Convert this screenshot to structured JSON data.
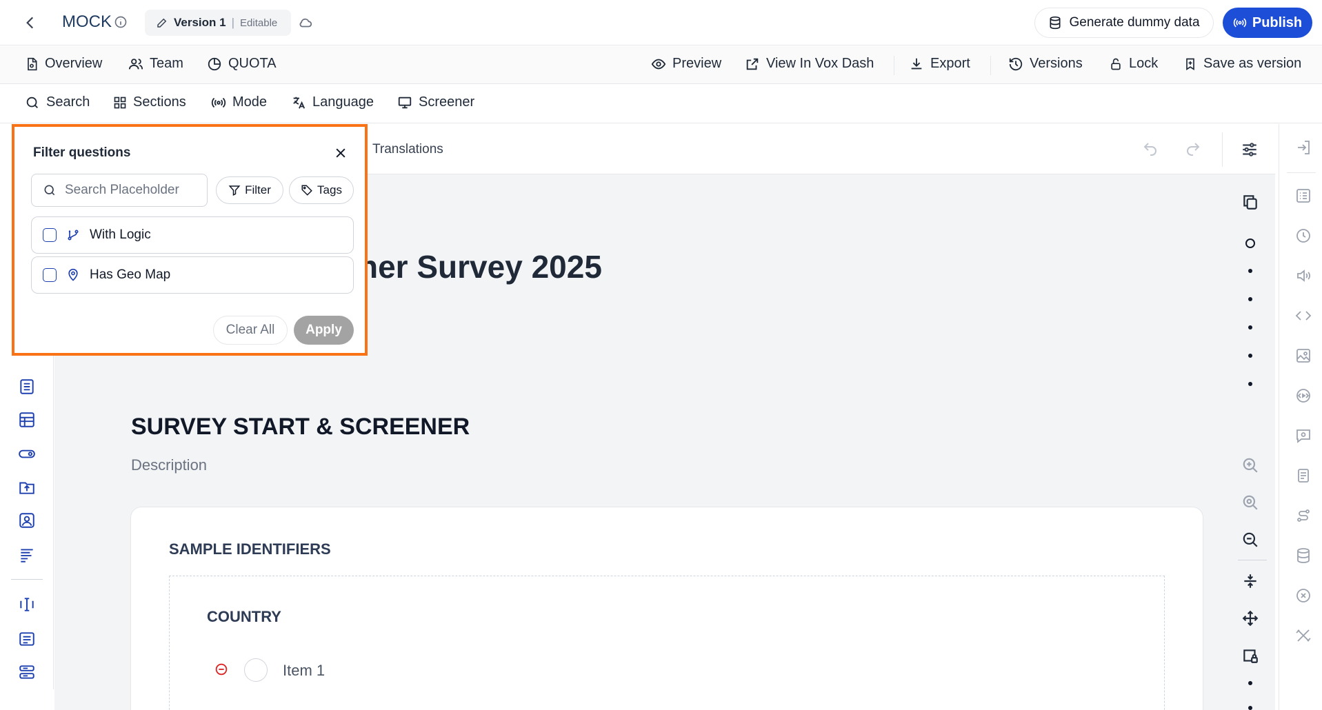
{
  "app": {
    "title": "MOCK",
    "version_label": "Version 1",
    "version_separator": "|",
    "version_status": "Editable"
  },
  "header_actions": {
    "generate_label": "Generate dummy data",
    "publish_label": "Publish"
  },
  "nav": {
    "overview": "Overview",
    "team": "Team",
    "quota": "QUOTA",
    "preview": "Preview",
    "view_in_vox_dash": "View In Vox Dash",
    "export": "Export",
    "versions": "Versions",
    "lock": "Lock",
    "save_as_version": "Save as version"
  },
  "toolbar": {
    "search": "Search",
    "sections": "Sections",
    "mode": "Mode",
    "language": "Language",
    "screener": "Screener"
  },
  "editor": {
    "translations_tab": "Translations",
    "survey_title_visible": "ner Survey 2025",
    "section_title": "SURVEY START & SCREENER",
    "section_description": "Description",
    "question_title": "SAMPLE IDENTIFIERS",
    "sub_question_title": "COUNTRY",
    "item_label": "Item 1"
  },
  "filter_popup": {
    "title": "Filter questions",
    "search_placeholder": "Search Placeholder",
    "search_value": "",
    "filter_label": "Filter",
    "tags_label": "Tags",
    "options": [
      {
        "label": "With Logic",
        "checked": false,
        "icon": "git-branch-icon"
      },
      {
        "label": "Has Geo Map",
        "checked": false,
        "icon": "map-pin-icon"
      }
    ],
    "clear_label": "Clear All",
    "apply_label": "Apply"
  },
  "colors": {
    "primary": "#1d4ed8",
    "highlight_border": "#f97316",
    "apply_disabled": "#a3a3a3",
    "danger": "#dc2626"
  }
}
